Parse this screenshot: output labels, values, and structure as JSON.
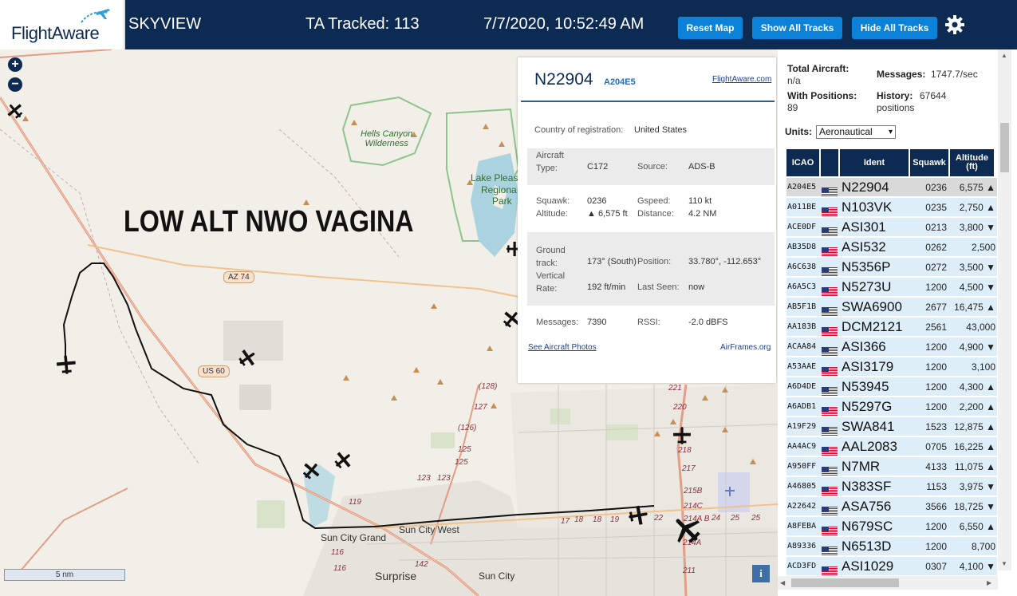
{
  "header": {
    "logo_text": "FlightAware",
    "app_name": "SKYVIEW",
    "tracked": "TA Tracked: 113",
    "datetime": "7/7/2020, 10:52:49 AM",
    "buttons": {
      "reset": "Reset Map",
      "show_all": "Show All Tracks",
      "hide_all": "Hide All Tracks"
    },
    "settings_icon": "gear-icon",
    "colors": {
      "bar": "#0d2b52",
      "button": "#0b82d8"
    }
  },
  "map": {
    "overlay_text": "LOW ALT NWO VAGINA",
    "zoom_in": "+",
    "zoom_out": "−",
    "scale_label": "5 nm",
    "info_label": "i",
    "labels": {
      "hells_canyon": "Hells Canyon\nWilderness",
      "lake_pleasant_1": "Lake Pleas",
      "lake_pleasant_2": "Regiona",
      "lake_pleasant_3": "Park",
      "az74": "AZ 74",
      "us60": "US 60",
      "sun_city_grand": "Sun City Grand",
      "sun_city_west": "Sun City West",
      "surprise": "Surprise",
      "sun_city": "Sun City",
      "r128": "(128)",
      "r127": "127",
      "r126": "(126)",
      "r125a": "125",
      "r125b": "125",
      "r123a": "123",
      "r123b": "123",
      "r119": "119",
      "r116a": "116",
      "r116b": "116",
      "r142": "142",
      "r221": "221",
      "r220": "220",
      "r218": "218",
      "r217": "217",
      "r215b": "215B",
      "r214c": "214C",
      "r214ab": "214A B",
      "r214a": "214A",
      "r211": "211",
      "r18": "18",
      "r17": "17",
      "r18b": "18",
      "r19": "19",
      "r22": "22",
      "r24": "24",
      "r25": "25",
      "r25b": "25"
    }
  },
  "popup": {
    "registration": "N22904",
    "hex": "A204E5",
    "fa_link": "FlightAware.com",
    "country_label": "Country of registration:",
    "country": "United States",
    "aircraft_type_label": "Aircraft\nType:",
    "aircraft_type": "C172",
    "source_label": "Source:",
    "source": "ADS-B",
    "squawk_label": "Squawk:",
    "squawk": "0236",
    "gspeed_label": "Gspeed:",
    "gspeed": "110 kt",
    "altitude_label": "Altitude:",
    "altitude": "▲ 6,575 ft",
    "distance_label": "Distance:",
    "distance": "4.2 NM",
    "track_label": "Ground\ntrack:",
    "track": "173° (South)",
    "position_label": "Position:",
    "position": "33.780°, -112.653°",
    "vrate_label": "Vertical\nRate:",
    "vrate": "192 ft/min",
    "lastseen_label": "Last Seen:",
    "lastseen": "now",
    "messages_label": "Messages:",
    "messages": "7390",
    "rssi_label": "RSSI:",
    "rssi": "-2.0 dBFS",
    "photos_link": "See Aircraft Photos",
    "airframes_link": "AirFrames.org"
  },
  "sidebar": {
    "total_aircraft_label": "Total Aircraft:",
    "total_aircraft": "n/a",
    "messages_label": "Messages:",
    "messages": "1747.7/sec",
    "with_positions_label": "With Positions:",
    "with_positions": "89",
    "history_label": "History:",
    "history": "67644",
    "history_unit": "positions",
    "units_label": "Units:",
    "units_value": "Aeronautical",
    "columns": {
      "icao": "ICAO",
      "ident": "Ident",
      "squawk": "Squawk",
      "altitude": "Altitude\n(ft)"
    },
    "rows": [
      {
        "icao": "A204E5",
        "ident": "N22904",
        "squawk": "0236",
        "alt": "6,575 ▲"
      },
      {
        "icao": "A011BE",
        "ident": "N103VK",
        "squawk": "0235",
        "alt": "2,750 ▲"
      },
      {
        "icao": "ACE0DF",
        "ident": "ASI301",
        "squawk": "0213",
        "alt": "3,800 ▼"
      },
      {
        "icao": "AB35D8",
        "ident": "ASI532",
        "squawk": "0262",
        "alt": "2,500"
      },
      {
        "icao": "A6C638",
        "ident": "N5356P",
        "squawk": "0272",
        "alt": "3,500 ▼"
      },
      {
        "icao": "A6A5C3",
        "ident": "N5273U",
        "squawk": "1200",
        "alt": "4,500 ▼"
      },
      {
        "icao": "AB5F1B",
        "ident": "SWA6900",
        "squawk": "2677",
        "alt": "16,475 ▲"
      },
      {
        "icao": "AA183B",
        "ident": "DCM2121",
        "squawk": "2561",
        "alt": "43,000"
      },
      {
        "icao": "ACAA84",
        "ident": "ASI366",
        "squawk": "1200",
        "alt": "4,900 ▼"
      },
      {
        "icao": "A53AAE",
        "ident": "ASI3179",
        "squawk": "1200",
        "alt": "3,100"
      },
      {
        "icao": "A6D4DE",
        "ident": "N53945",
        "squawk": "1200",
        "alt": "4,300 ▲"
      },
      {
        "icao": "A6ADB1",
        "ident": "N5297G",
        "squawk": "1200",
        "alt": "2,200 ▲"
      },
      {
        "icao": "A19F29",
        "ident": "SWA841",
        "squawk": "1523",
        "alt": "12,875 ▲"
      },
      {
        "icao": "AA4AC9",
        "ident": "AAL2083",
        "squawk": "0705",
        "alt": "16,225 ▲"
      },
      {
        "icao": "A950FF",
        "ident": "N7MR",
        "squawk": "4133",
        "alt": "11,075 ▲"
      },
      {
        "icao": "A46805",
        "ident": "N383SF",
        "squawk": "1153",
        "alt": "3,975 ▼"
      },
      {
        "icao": "A22642",
        "ident": "ASA756",
        "squawk": "3566",
        "alt": "18,725 ▼"
      },
      {
        "icao": "A8FEBA",
        "ident": "N679SC",
        "squawk": "1200",
        "alt": "6,550 ▲"
      },
      {
        "icao": "A89336",
        "ident": "N6513D",
        "squawk": "1200",
        "alt": "8,700"
      },
      {
        "icao": "ACD3FD",
        "ident": "ASI1029",
        "squawk": "0307",
        "alt": "4,100 ▼"
      }
    ],
    "row_colors": {
      "selected": "#d9d9d9",
      "normal": "#ddeef9"
    }
  }
}
